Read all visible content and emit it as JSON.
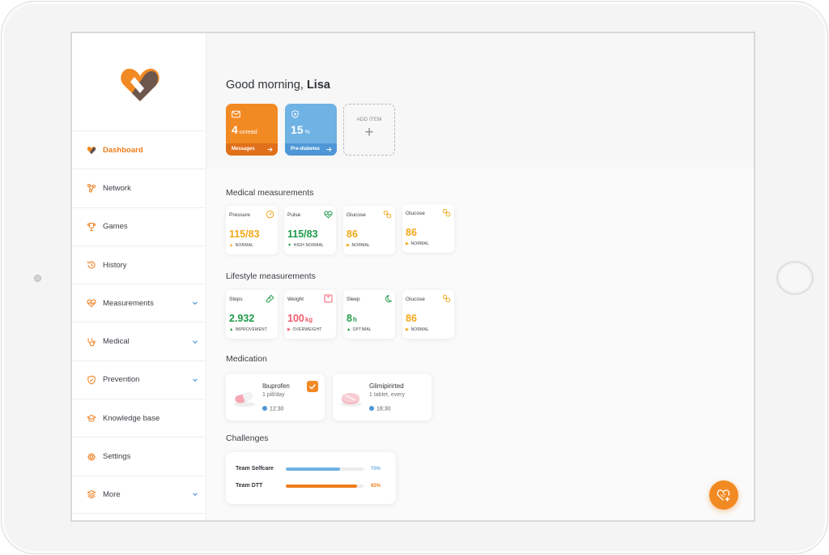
{
  "sidebar": {
    "items": [
      {
        "label": "Dashboard",
        "icon": "heart-logo-icon"
      },
      {
        "label": "Network",
        "icon": "network-icon"
      },
      {
        "label": "Games",
        "icon": "trophy-icon"
      },
      {
        "label": "History",
        "icon": "history-icon"
      },
      {
        "label": "Measurements",
        "icon": "heart-pulse-icon"
      },
      {
        "label": "Medical",
        "icon": "stethoscope-icon"
      },
      {
        "label": "Prevention",
        "icon": "shield-icon"
      },
      {
        "label": "Knowledge base",
        "icon": "graduation-cap-icon"
      },
      {
        "label": "Settings",
        "icon": "gear-icon"
      },
      {
        "label": "More",
        "icon": "layers-icon"
      }
    ]
  },
  "greeting": {
    "prefix": "Good morning,",
    "name": "Lisa"
  },
  "tiles": {
    "messages": {
      "value": "4",
      "unit": "unread",
      "label": "Messages",
      "icon": "mail-icon"
    },
    "prediabetes": {
      "value": "15",
      "unit": "%",
      "label": "Pre-diabetes",
      "icon": "shield-plus-icon"
    },
    "add": {
      "label": "ADD ITEM",
      "symbol": "+"
    }
  },
  "sections": {
    "medical": "Medical measurements",
    "lifestyle": "Lifestyle measurements",
    "medication": "Medication",
    "challenges": "Challenges"
  },
  "medical": [
    {
      "label": "Pressure",
      "value": "115/83",
      "unit": "",
      "status": "NORMAL",
      "color": "#f2a81a",
      "icon": "gauge-icon"
    },
    {
      "label": "Pulse",
      "value": "115/83",
      "unit": "",
      "status": "HIGH NORMAL",
      "color": "#1f9a4a",
      "icon": "heart-pulse-icon"
    },
    {
      "label": "Glucose",
      "value": "86",
      "unit": "",
      "status": "NORMAL",
      "color": "#f2a81a",
      "icon": "glucose-icon"
    },
    {
      "label": "Glucose",
      "value": "86",
      "unit": "",
      "status": "NORMAL",
      "color": "#f2a81a",
      "icon": "glucose-icon"
    }
  ],
  "lifestyle": [
    {
      "label": "Steps",
      "value": "2.932",
      "unit": "",
      "status": "IMPROVEMENT",
      "color": "#1f9a4a",
      "icon": "shoe-icon"
    },
    {
      "label": "Weight",
      "value": "100",
      "unit": "kg",
      "status": "OVERWEIGHT",
      "color": "#ef5b6f",
      "icon": "scale-icon"
    },
    {
      "label": "Sleep",
      "value": "8",
      "unit": "h",
      "status": "OPTIMAL",
      "color": "#1f9a4a",
      "icon": "moon-icon"
    },
    {
      "label": "Glucose",
      "value": "86",
      "unit": "",
      "status": "NORMAL",
      "color": "#f2a81a",
      "icon": "glucose-icon"
    }
  ],
  "medication": [
    {
      "name": "Ibuprofen",
      "dose": "1 pill/day",
      "time": "12:30",
      "checked": true
    },
    {
      "name": "Glimipirirted",
      "dose": "1 tablet, every",
      "time": "18:30",
      "checked": false
    }
  ],
  "challenges": [
    {
      "team": "Team Selfcare",
      "percent": "70%",
      "value": 0.7,
      "color": "#6fb2e4"
    },
    {
      "team": "Team DTT",
      "percent": "92%",
      "value": 0.92,
      "color": "#ef7d1a"
    }
  ],
  "colors": {
    "accent": "#ef7d1a",
    "blue": "#4e97d6",
    "green": "#1f9a4a",
    "yellow": "#f2a81a",
    "red": "#ef5b6f"
  }
}
